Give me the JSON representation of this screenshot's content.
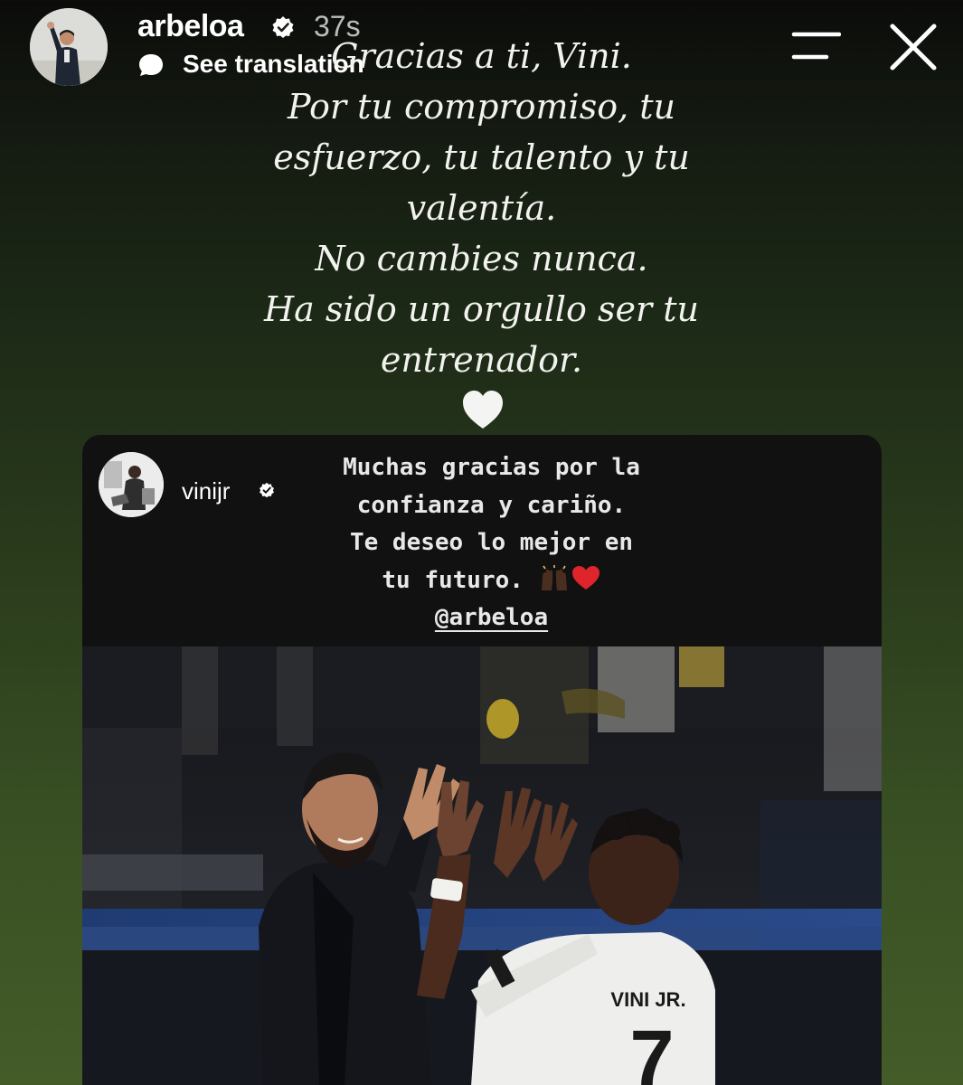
{
  "header": {
    "username": "arbeloa",
    "timestamp": "37s",
    "see_translation": "See translation",
    "icons": {
      "verified": "verified-badge-icon",
      "translate": "translate-bubble-icon",
      "menu": "menu-icon",
      "close": "close-icon"
    }
  },
  "story": {
    "lines": [
      "Gracias a ti, Vini.",
      "Por tu compromiso, tu",
      "esfuerzo, tu talento y tu",
      "valentía.",
      "No cambies nunca.",
      "Ha sido un orgullo ser tu",
      "entrenador."
    ],
    "heart_emoji": "white-heart"
  },
  "shared_post": {
    "username": "vinijr",
    "message_lines": [
      "Muchas gracias por la",
      "confianza y cariño.",
      "Te deseo lo mejor en",
      "tu futuro."
    ],
    "emojis": [
      "raising-hands-dark-skin-tone",
      "red-heart"
    ],
    "mention": "@arbeloa",
    "photo_text": {
      "jersey_name": "VINI JR.",
      "jersey_number": "7"
    }
  },
  "colors": {
    "background_top": "#0b0c0a",
    "background_bottom": "#435c28",
    "card_background": "#111111",
    "text": "#ffffff",
    "timestamp": "rgba(255,255,255,0.72)"
  }
}
